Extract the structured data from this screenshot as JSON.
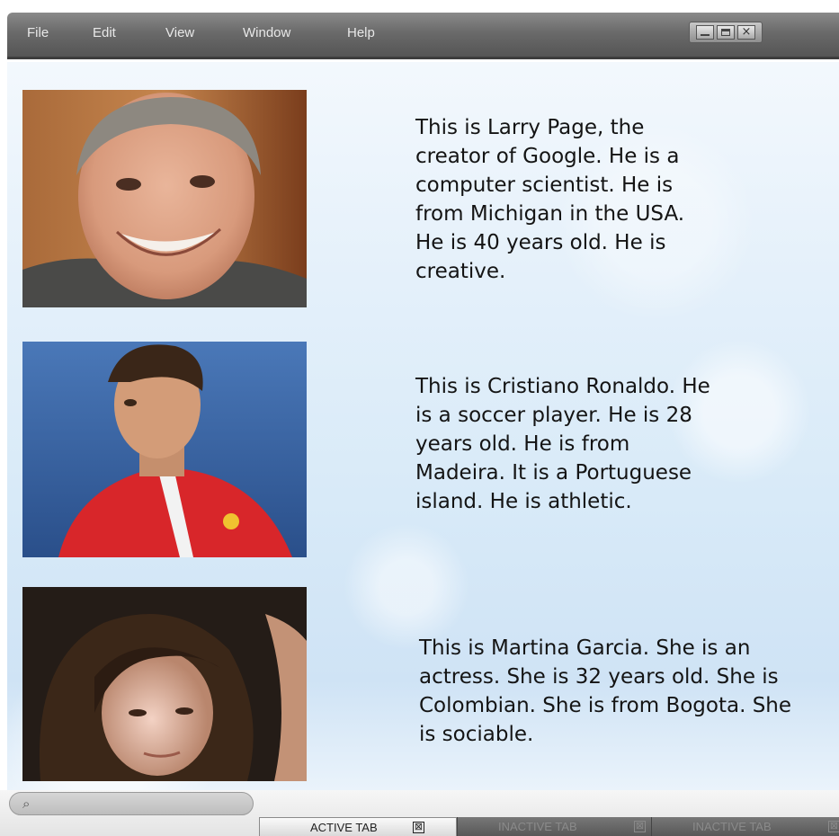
{
  "menubar": {
    "items": [
      "File",
      "Edit",
      "View",
      "Window",
      "Help"
    ]
  },
  "window_controls": {
    "close_glyph": "×"
  },
  "profiles": [
    {
      "photo": "larry-page-portrait",
      "text": "This is Larry Page, the creator of Google. He is a computer scientist. He is from Michigan in the USA. He is 40 years old. He is creative."
    },
    {
      "photo": "cristiano-ronaldo-portrait",
      "text": "This is Cristiano Ronaldo. He is a soccer player. He is 28 years old. He is from Madeira. It is a Portuguese island. He is athletic."
    },
    {
      "photo": "martina-garcia-portrait",
      "text": "This is Martina Garcia. She is an actress. She is 32 years old. She is Colombian. She is from Bogota. She is sociable."
    }
  ],
  "search": {
    "icon": "search-icon"
  },
  "tabs": [
    {
      "label": "ACTIVE TAB",
      "close": "⊠",
      "state": "active"
    },
    {
      "label": "INACTIVE TAB",
      "close": "⊠",
      "state": "inactive"
    },
    {
      "label": "INACTIVE TAB",
      "close": "⊠",
      "state": "inactive"
    }
  ],
  "colors": {
    "menubar": "#6a6a6a",
    "content_background": "#d8eaf8",
    "text": "#141414"
  }
}
